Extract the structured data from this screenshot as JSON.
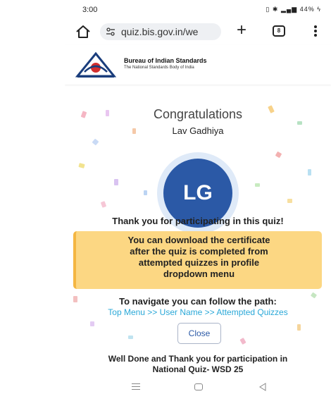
{
  "status": {
    "time": "3:00",
    "battery": "44%"
  },
  "browser": {
    "url": "quiz.bis.gov.in/we",
    "tab_count": "8"
  },
  "site": {
    "org_name": "Bureau of Indian Standards",
    "org_sub": "The National Standards Body of India"
  },
  "result": {
    "heading": "Congratulations",
    "user_name": "Lav Gadhiya",
    "initials": "LG",
    "thanks": "Thank you for participating in this quiz!",
    "note_line1": "You can download the certificate",
    "note_line2": "after the quiz is completed from",
    "note_line3": "attempted quizzes in profile",
    "note_line4": "dropdown menu",
    "nav_title": "To navigate you can follow the path:",
    "nav_path": "Top Menu >> User Name >> Attempted Quizzes",
    "close_label": "Close",
    "well_done_line1": "Well Done and Thank you for participation in",
    "well_done_line2": "National Quiz- WSD 25"
  },
  "colors": {
    "avatar": "#2b59a6",
    "note_bg": "#fcd783",
    "path_link": "#2aa8d8"
  }
}
